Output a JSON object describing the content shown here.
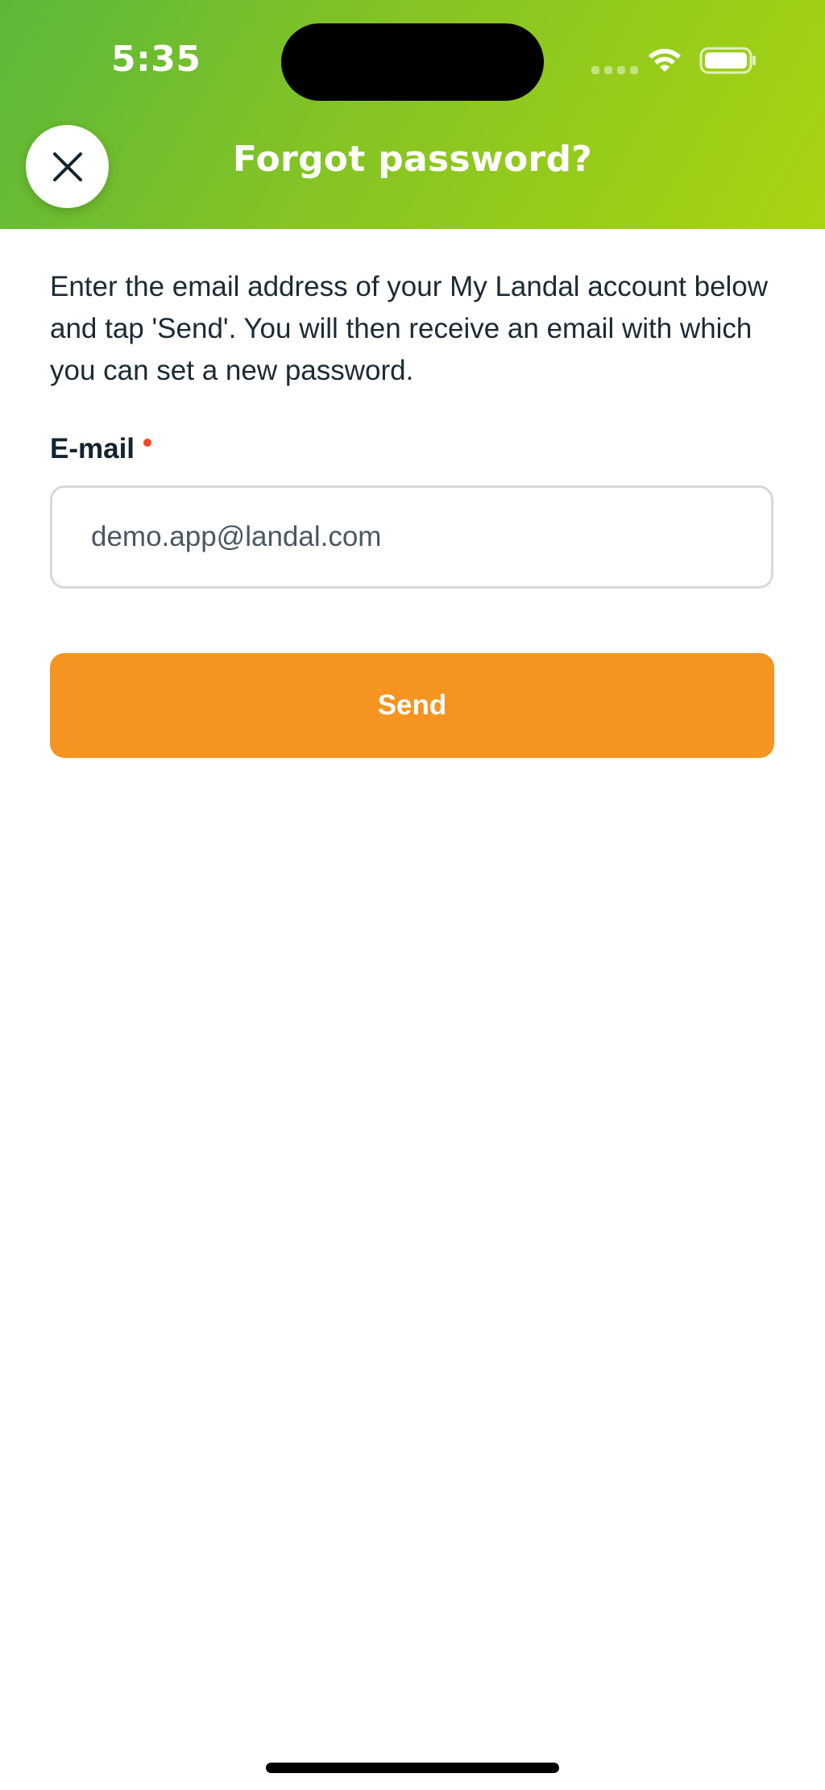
{
  "status_bar": {
    "time": "5:35",
    "wifi_icon": "wifi-icon",
    "battery_icon": "battery-icon"
  },
  "header": {
    "title": "Forgot password?",
    "close_icon": "close-icon",
    "gradient_start": "#5cb83a",
    "gradient_end": "#a9d411"
  },
  "content": {
    "intro": "Enter the email address of your My Landal account below and tap 'Send'. You will then receive an email with which you can set a new password.",
    "email_label": "E-mail",
    "email_value": "demo.app@landal.com",
    "required_color": "#ef4a23"
  },
  "actions": {
    "send_label": "Send",
    "send_color": "#f59421"
  }
}
